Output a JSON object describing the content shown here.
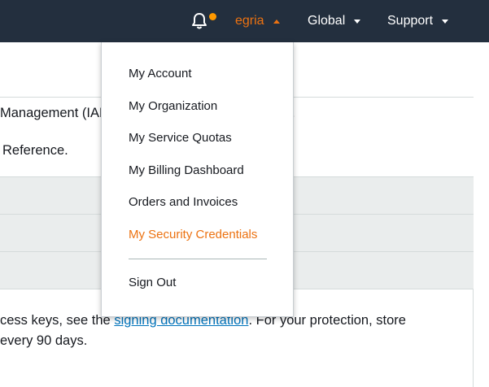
{
  "topbar": {
    "account_name": "egria",
    "region_label": "Global",
    "support_label": "Support"
  },
  "account_menu": {
    "items": [
      {
        "label": "My Account"
      },
      {
        "label": "My Organization"
      },
      {
        "label": "My Service Quotas"
      },
      {
        "label": "My Billing Dashboard"
      },
      {
        "label": "Orders and Invoices"
      },
      {
        "label": "My Security Credentials",
        "active": true
      }
    ],
    "sign_out_label": "Sign Out"
  },
  "page": {
    "line1_text": "Management (IAM",
    "line1_tail": ".",
    "line2_text": "Reference.",
    "bottom_line1_prefix": "cess keys, see the ",
    "bottom_line1_link": "signing documentation",
    "bottom_line1_suffix": ". For your protection, store",
    "bottom_line2": "every 90 days."
  },
  "colors": {
    "topbar_bg": "#232f3e",
    "accent": "#ec7211",
    "notification_dot": "#ff9900",
    "link": "#0073bb"
  },
  "icons": {
    "notifications": "bell-icon"
  }
}
